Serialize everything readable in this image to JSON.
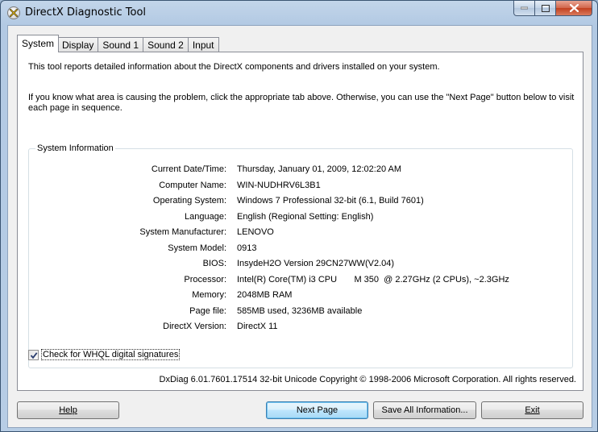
{
  "window": {
    "title": "DirectX Diagnostic Tool"
  },
  "tabs": [
    {
      "label": "System",
      "active": true
    },
    {
      "label": "Display",
      "active": false
    },
    {
      "label": "Sound 1",
      "active": false
    },
    {
      "label": "Sound 2",
      "active": false
    },
    {
      "label": "Input",
      "active": false
    }
  ],
  "intro": {
    "line1": "This tool reports detailed information about the DirectX components and drivers installed on your system.",
    "line2": "If you know what area is causing the problem, click the appropriate tab above.  Otherwise, you can use the \"Next Page\" button below to visit each page in sequence."
  },
  "system_info": {
    "group_title": "System Information",
    "rows": [
      {
        "label": "Current Date/Time:",
        "value": "Thursday, January 01, 2009, 12:02:20 AM"
      },
      {
        "label": "Computer Name:",
        "value": "WIN-NUDHRV6L3B1"
      },
      {
        "label": "Operating System:",
        "value": "Windows 7 Professional 32-bit (6.1, Build 7601)"
      },
      {
        "label": "Language:",
        "value": "English (Regional Setting: English)"
      },
      {
        "label": "System Manufacturer:",
        "value": "LENOVO"
      },
      {
        "label": "System Model:",
        "value": "0913"
      },
      {
        "label": "BIOS:",
        "value": "InsydeH2O Version 29CN27WW(V2.04)"
      },
      {
        "label": "Processor:",
        "value": "Intel(R) Core(TM) i3 CPU       M 350  @ 2.27GHz (2 CPUs), ~2.3GHz"
      },
      {
        "label": "Memory:",
        "value": "2048MB RAM"
      },
      {
        "label": "Page file:",
        "value": "585MB used, 3236MB available"
      },
      {
        "label": "DirectX Version:",
        "value": "DirectX 11"
      }
    ]
  },
  "whql": {
    "label": "Check for WHQL digital signatures",
    "checked": true
  },
  "copyright": "DxDiag 6.01.7601.17514 32-bit Unicode  Copyright © 1998-2006 Microsoft Corporation.  All rights reserved.",
  "buttons": {
    "help": "Help",
    "next_page": "Next Page",
    "save_all": "Save All Information...",
    "exit": "Exit"
  },
  "colors": {
    "titlebar": "#b7cde5",
    "panel": "#ffffff",
    "default_button_border": "#3c7fb1",
    "close_button": "#c2401f"
  }
}
